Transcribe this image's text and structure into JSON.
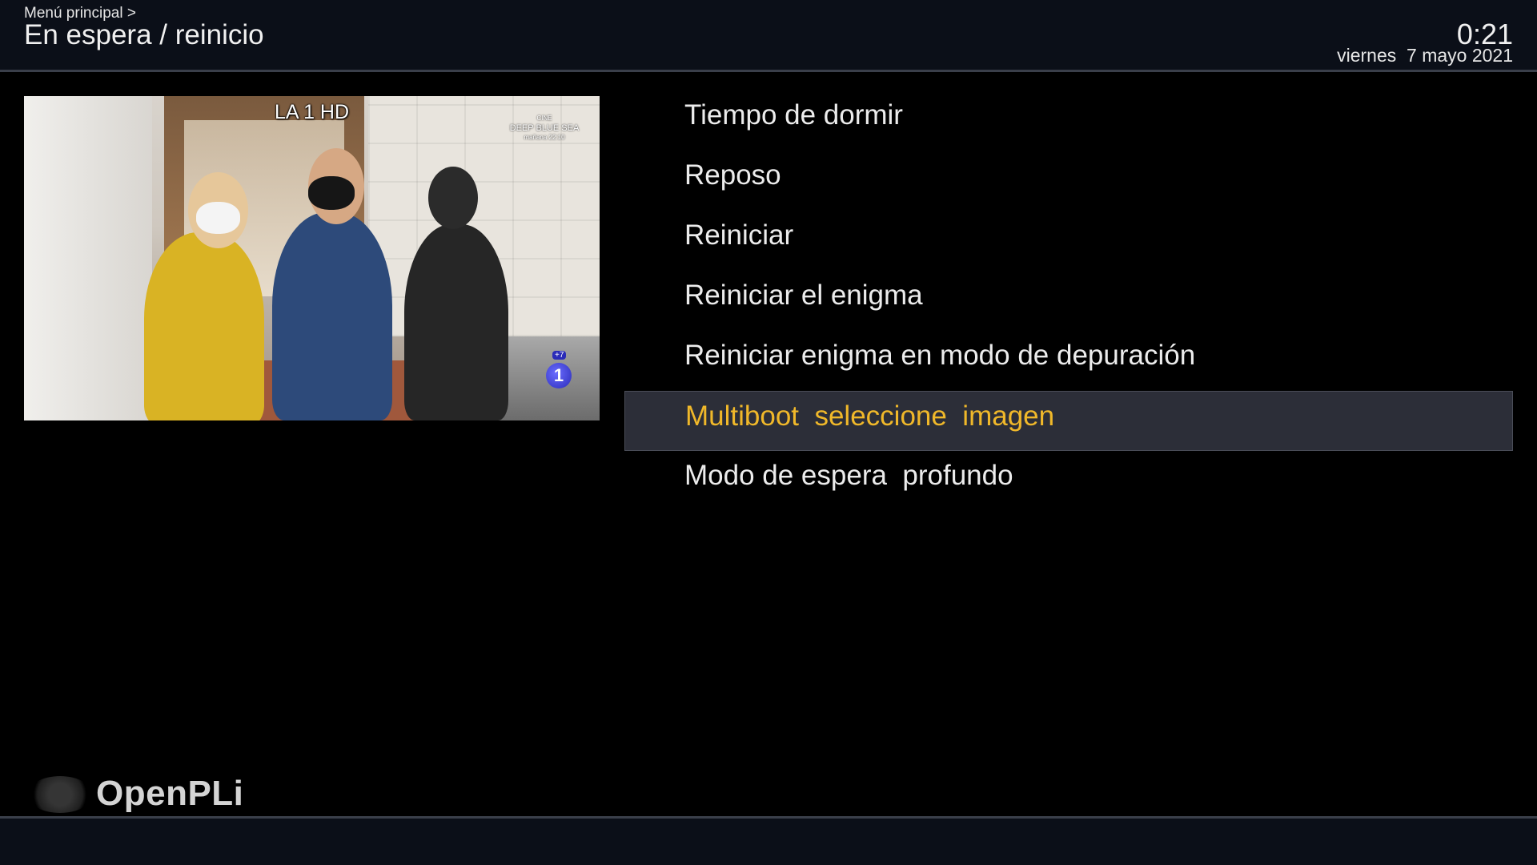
{
  "header": {
    "breadcrumb": "Menú principal >",
    "title": "En espera / reinicio",
    "clock": "0:21",
    "date": "viernes  7 mayo 2021"
  },
  "preview": {
    "channel_name": "LA 1 HD",
    "promo_line1": "CINE",
    "promo_line2": "DEEP BLUE SEA",
    "promo_line3": "mañana 22:10",
    "channel_logo": "1",
    "channel_logo_badge": "+7"
  },
  "menu": {
    "selected_index": 5,
    "items": [
      {
        "label": "Tiempo de dormir"
      },
      {
        "label": "Reposo"
      },
      {
        "label": "Reiniciar"
      },
      {
        "label": "Reiniciar el enigma"
      },
      {
        "label": "Reiniciar enigma en modo de depuración"
      },
      {
        "label": "Multiboot  seleccione  imagen"
      },
      {
        "label": "Modo de espera  profundo"
      }
    ]
  },
  "footer": {
    "brand": "OpenPLi"
  },
  "colors": {
    "selected_text": "#f0b82a",
    "selected_bg": "#2c2e38",
    "header_bg": "#0b0f18"
  }
}
